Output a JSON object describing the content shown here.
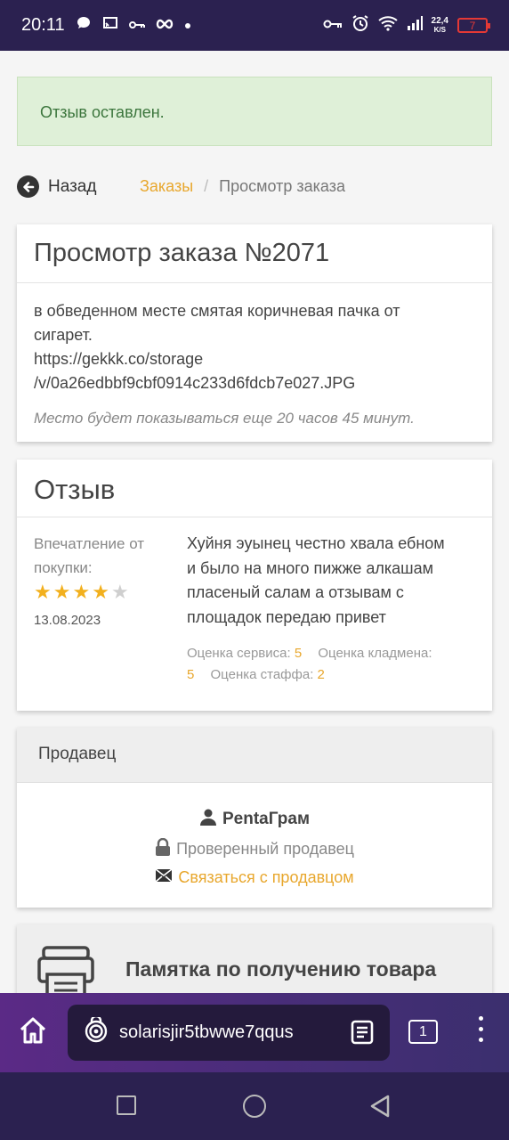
{
  "status_bar": {
    "time": "20:11",
    "net_speed_value": "22,4",
    "net_speed_unit": "K/S",
    "battery_level": "7"
  },
  "alert": {
    "text": "Отзыв оставлен."
  },
  "nav": {
    "back_label": "Назад",
    "breadcrumb_link": "Заказы",
    "breadcrumb_separator": "/",
    "breadcrumb_current": "Просмотр заказа"
  },
  "order": {
    "title": "Просмотр заказа №2071",
    "description_line1": "в обведенном месте смятая коричневая пачка от",
    "description_line2": "сигарет.",
    "link_line1": "https://gekkk.co/storage",
    "link_line2": "/v/0a26edbbf9cbf0914c233d6fdcb7e027.JPG",
    "visibility_note": "Место будет показываться еще 20 часов 45 минут."
  },
  "review": {
    "title": "Отзыв",
    "impression_label_line1": "Впечатление от",
    "impression_label_line2": "покупки:",
    "rating": 4,
    "rating_max": 5,
    "date": "13.08.2023",
    "text_line1": "Хуйня эуынец честно хвала ебном",
    "text_line2": "и было на много пижже алкашам",
    "text_line3": "пласеный салам а отзывам с",
    "text_line4": "площадок передаю привет",
    "service_label": "Оценка сервиса:",
    "service_value": "5",
    "courier_label": "Оценка кладмена:",
    "courier_value": "5",
    "staff_label": "Оценка стаффа:",
    "staff_value": "2"
  },
  "seller": {
    "header": "Продавец",
    "name": "PentaГрам",
    "verified": "Проверенный продавец",
    "contact": "Связаться с продавцом"
  },
  "memo": {
    "title": "Памятка по получению товара"
  },
  "browser": {
    "url": "solarisjir5tbwwe7qqus",
    "tab_count": "1"
  },
  "colors": {
    "accent": "#e8a72d",
    "alert_bg": "#dff0d8",
    "alert_text": "#3c763d",
    "status_bar": "#2b2150"
  },
  "icons": [
    "home-icon",
    "site-security-icon",
    "reader-mode-icon",
    "tabs-icon",
    "menu-icon",
    "user-icon",
    "lock-icon",
    "envelope-icon",
    "printer-icon",
    "back-arrow-icon"
  ]
}
